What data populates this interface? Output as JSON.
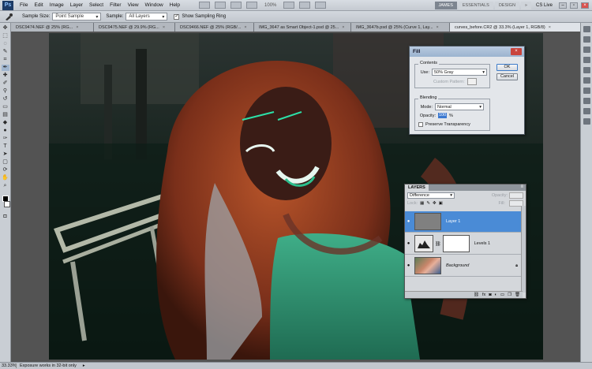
{
  "app": {
    "logo": "Ps"
  },
  "menu": [
    "File",
    "Edit",
    "Image",
    "Layer",
    "Select",
    "Filter",
    "View",
    "Window",
    "Help"
  ],
  "zoom_menu": "100%",
  "workspace": {
    "items": [
      "JAMES",
      "ESSENTIALS",
      "DESIGN"
    ],
    "more": "»",
    "cs_live": "CS Live"
  },
  "options_bar": {
    "sample_size_label": "Sample Size:",
    "sample_size_value": "Point Sample",
    "sample_label": "Sample:",
    "sample_value": "All Layers",
    "ring_label": "Show Sampling Ring",
    "ring_checked": true
  },
  "tabs": [
    {
      "label": "DSC9474.NEF @ 25% (RG..."
    },
    {
      "label": "DSC9475.NEF @ 29.9% (RG..."
    },
    {
      "label": "DSC9466.NEF @ 25% (RGB/..."
    },
    {
      "label": "IMG_3647 as Smart Object-1.psd @ 25..."
    },
    {
      "label": "IMG_3647b.psd @ 25% (Curve 1, Lay..."
    },
    {
      "label": "curves_before.CR2 @ 33.3% (Layer 1, RGB/8)",
      "active": true
    }
  ],
  "status": {
    "zoom": "33.33%",
    "message": "Exposure works in 32-bit only",
    "arrow": "▸"
  },
  "fill_dialog": {
    "title": "Fill",
    "contents_label": "Contents",
    "use_label": "Use:",
    "use_value": "50% Gray",
    "custom_pattern_label": "Custom Pattern:",
    "blending_label": "Blending",
    "mode_label": "Mode:",
    "mode_value": "Normal",
    "opacity_label": "Opacity:",
    "opacity_value": "100",
    "opacity_unit": "%",
    "preserve_label": "Preserve Transparency",
    "ok_label": "OK",
    "cancel_label": "Cancel"
  },
  "layers_panel": {
    "tab": "LAYERS",
    "blend_mode": "Difference",
    "opacity_label": "Opacity:",
    "lock_label": "Lock:",
    "fill_label": "Fill:",
    "layers": [
      {
        "name": "Layer 1",
        "selected": true
      },
      {
        "name": "Levels 1",
        "selected": false
      },
      {
        "name": "Background",
        "selected": false
      }
    ]
  },
  "colors": {
    "selected_layer": "#4a8bd6",
    "opacity_highlight": "#3b78d0"
  }
}
